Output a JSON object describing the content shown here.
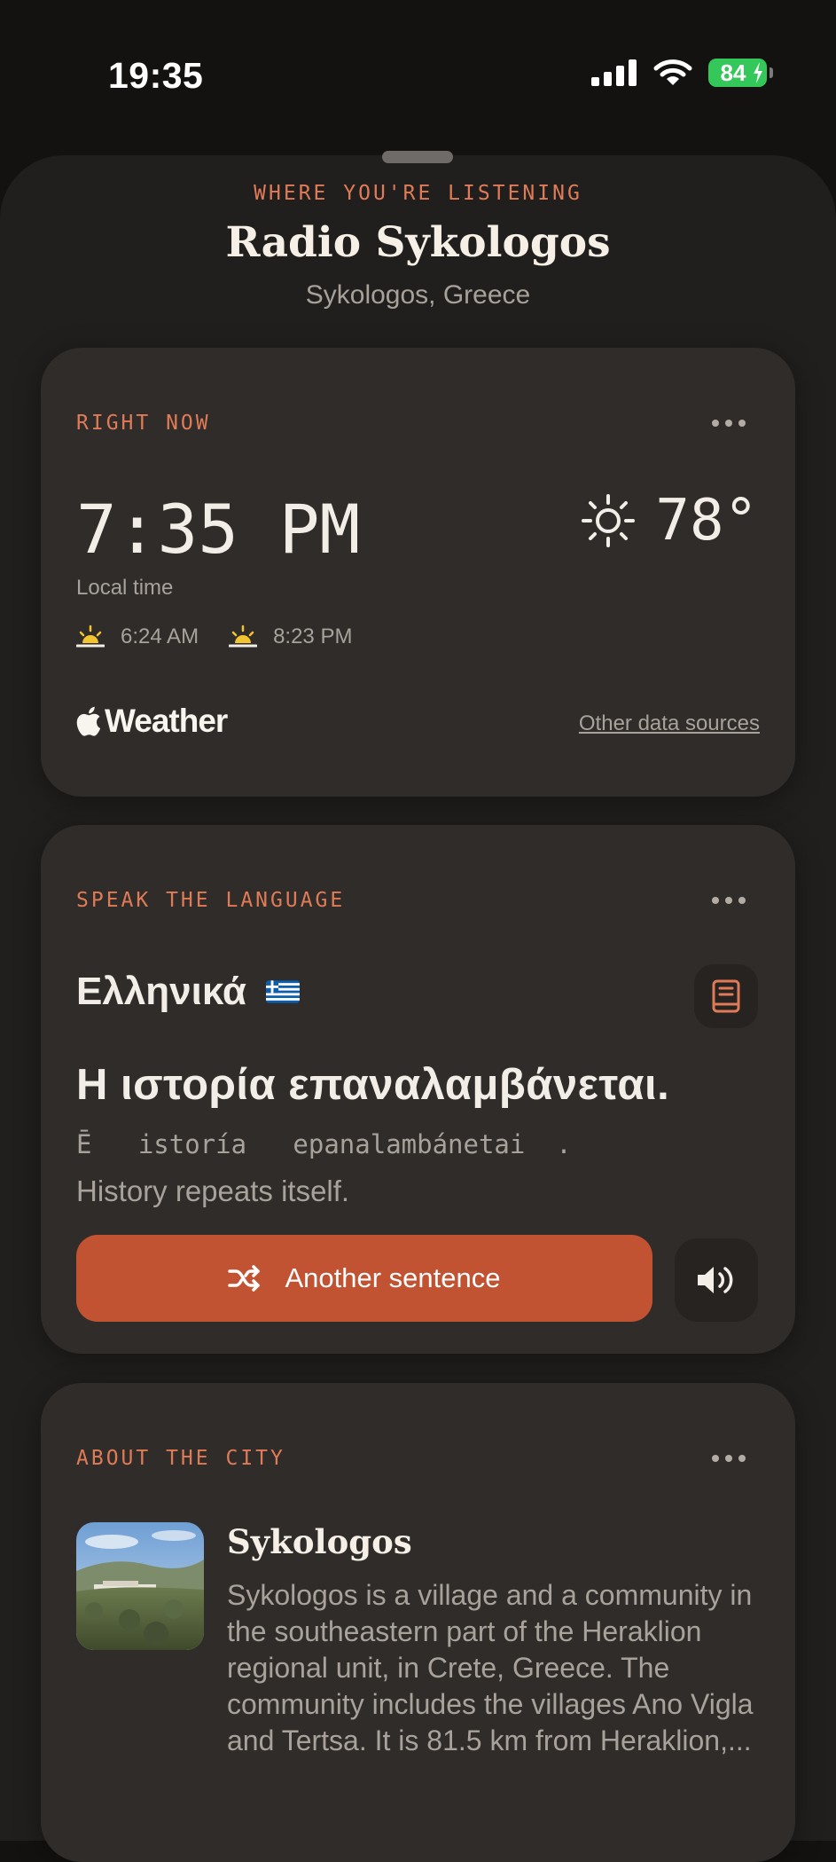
{
  "status": {
    "time": "19:35",
    "battery": "84"
  },
  "header": {
    "eyebrow": "WHERE YOU'RE LISTENING",
    "title": "Radio Sykologos",
    "subtitle": "Sykologos, Greece"
  },
  "right_now": {
    "eyebrow": "RIGHT NOW",
    "time": "7:35 PM",
    "time_label": "Local time",
    "temperature": "78°",
    "sunrise": "6:24 AM",
    "sunset": "8:23 PM",
    "brand": "Weather",
    "other_sources": "Other data sources"
  },
  "language": {
    "eyebrow": "SPEAK THE LANGUAGE",
    "name": "Ελληνικά",
    "sentence": "Η ιστορία επαναλαμβάνεται.",
    "transliteration": "Ē   istoría   epanalambánetai  .",
    "translation": "History repeats itself.",
    "button_label": "Another sentence"
  },
  "about": {
    "eyebrow": "ABOUT THE CITY",
    "city_name": "Sykologos",
    "description": "Sykologos is a village and a community in the southeastern part of the Heraklion regional unit, in Crete, Greece. The community includes the villages Ano Vigla and Tertsa. It is 81.5 km from Heraklion,..."
  },
  "colors": {
    "accent": "#e07b57",
    "button": "#c15332",
    "card": "#2f2c2a",
    "sheet": "#211f1d",
    "background": "#141211",
    "battery": "#34c759"
  }
}
